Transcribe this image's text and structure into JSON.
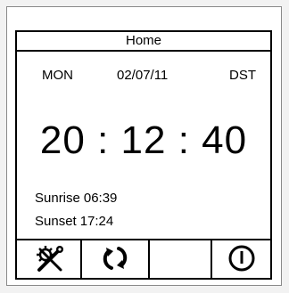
{
  "header": {
    "title": "Home"
  },
  "date_row": {
    "day": "MON",
    "date": "02/07/11",
    "dst": "DST"
  },
  "clock": {
    "time": "20 : 12 : 40"
  },
  "sun": {
    "sunrise_label": "Sunrise",
    "sunrise_time": "06:39",
    "sunset_label": "Sunset",
    "sunset_time": "17:24"
  },
  "toolbar": {
    "buttons": [
      {
        "icon": "settings-tools-icon"
      },
      {
        "icon": "refresh-icon"
      },
      {
        "icon": "blank"
      },
      {
        "icon": "power-icon"
      }
    ]
  }
}
